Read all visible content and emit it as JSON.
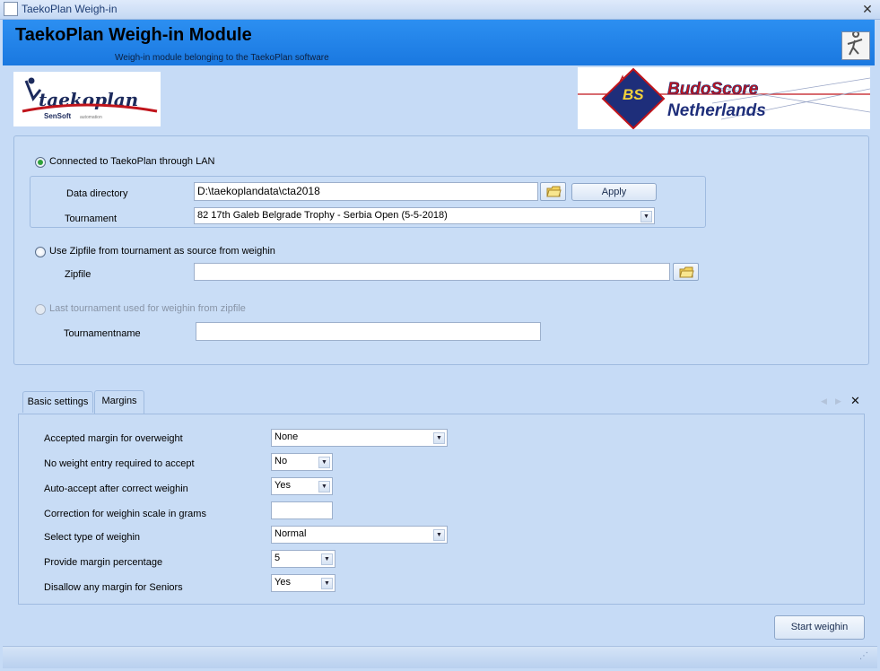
{
  "window": {
    "title": "TaekoPlan Weigh-in"
  },
  "header": {
    "title": "TaekoPlan Weigh-in Module",
    "subtitle": "Weigh-in module belonging to the TaekoPlan software"
  },
  "logos": {
    "taekoplan": "taekoplan",
    "taekoplan_brand": "SenSoft",
    "taekoplan_brand_sub": "automation",
    "budoscore_mark": "BS",
    "budoscore_line1": "BudoScore",
    "budoscore_line2": "Netherlands"
  },
  "source": {
    "lan_label": "Connected to TaekoPlan through LAN",
    "data_dir_label": "Data directory",
    "data_dir_value": "D:\\taekoplandata\\cta2018",
    "apply_label": "Apply",
    "tournament_label": "Tournament",
    "tournament_value": "82 17th Galeb Belgrade Trophy -  Serbia Open (5-5-2018)",
    "zip_label": "Use Zipfile from tournament as source from weighin",
    "zipfile_label": "Zipfile",
    "zipfile_value": "",
    "last_label": "Last tournament used for weighin from zipfile",
    "tournamentname_label": "Tournamentname",
    "tournamentname_value": ""
  },
  "tabs": [
    {
      "label": "Basic settings"
    },
    {
      "label": "Margins"
    }
  ],
  "margins": [
    {
      "label": "Accepted margin for overweight",
      "value": "None"
    },
    {
      "label": "No weight entry required to accept",
      "value": "No"
    },
    {
      "label": "Auto-accept after correct weighin",
      "value": "Yes"
    },
    {
      "label": "Correction for weighin scale in grams",
      "value": ""
    },
    {
      "label": "Select type of weighin",
      "value": "Normal"
    },
    {
      "label": "Provide margin percentage",
      "value": "5"
    },
    {
      "label": "Disallow any margin for Seniors",
      "value": "Yes"
    }
  ],
  "actions": {
    "start_label": "Start weighin"
  }
}
